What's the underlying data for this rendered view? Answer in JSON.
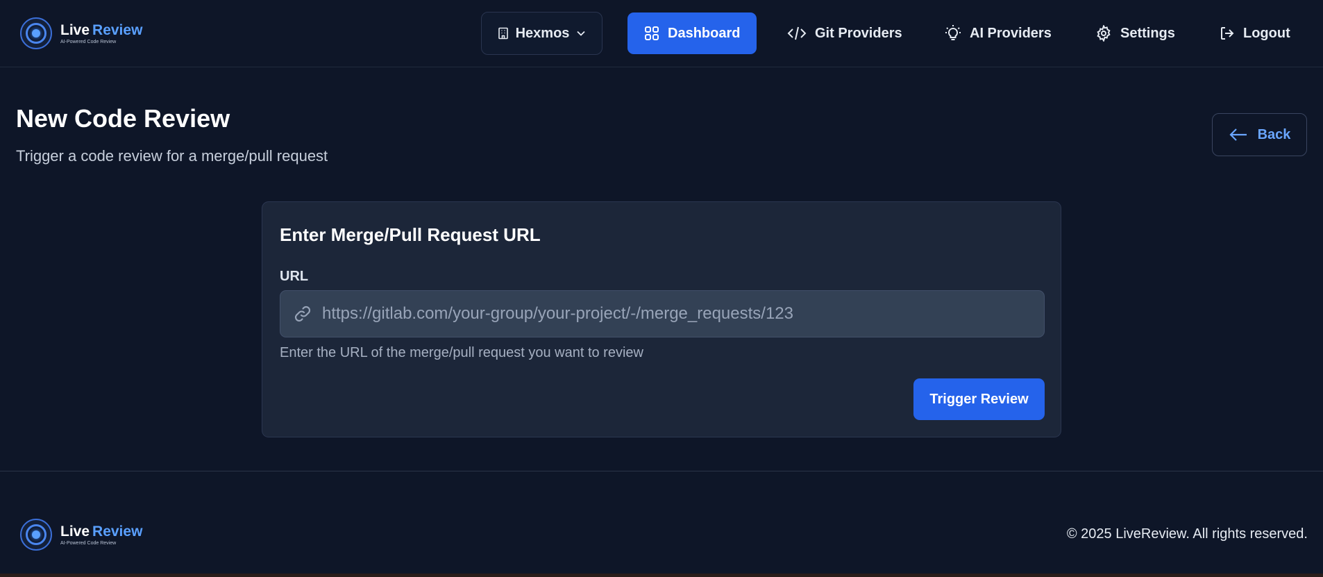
{
  "brand": {
    "name_part1": "Live",
    "name_part2": "Review",
    "tagline": "AI-Powered Code Review"
  },
  "header": {
    "org_selector": {
      "label": "Hexmos",
      "icon": "building-icon"
    },
    "nav": [
      {
        "label": "Dashboard",
        "icon": "grid-icon",
        "active": true
      },
      {
        "label": "Git Providers",
        "icon": "code-icon",
        "active": false
      },
      {
        "label": "AI Providers",
        "icon": "lightbulb-icon",
        "active": false
      },
      {
        "label": "Settings",
        "icon": "gear-icon",
        "active": false
      },
      {
        "label": "Logout",
        "icon": "logout-icon",
        "active": false
      }
    ]
  },
  "page": {
    "title": "New Code Review",
    "subtitle": "Trigger a code review for a merge/pull request",
    "back_label": "Back"
  },
  "card": {
    "title": "Enter Merge/Pull Request URL",
    "field_label": "URL",
    "input_value": "",
    "input_placeholder": "https://gitlab.com/your-group/your-project/-/merge_requests/123",
    "help_text": "Enter the URL of the merge/pull request you want to review",
    "submit_label": "Trigger Review"
  },
  "footer": {
    "copyright": "© 2025 LiveReview. All rights reserved."
  },
  "colors": {
    "background": "#0e1628",
    "card": "#1c2639",
    "accent": "#2563eb",
    "link": "#6aa6ff"
  }
}
